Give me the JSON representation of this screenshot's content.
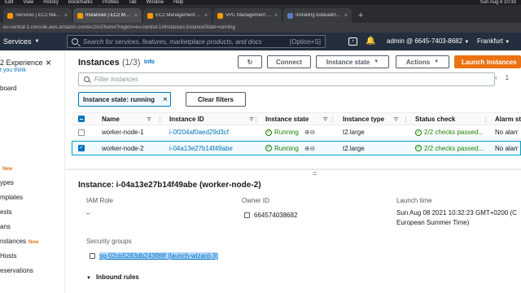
{
  "macbar": {
    "items": [
      "Edit",
      "View",
      "History",
      "Bookmarks",
      "Profiles",
      "Tab",
      "Window",
      "Help"
    ],
    "clock": "Sun Aug 8 10:33"
  },
  "browser": {
    "tabs": [
      {
        "title": "Services | EC2 Management Console",
        "icon": "aws-icon"
      },
      {
        "title": "Instances | EC2 Management Console",
        "icon": "aws-icon",
        "active": true
      },
      {
        "title": "EC2 Management Console",
        "icon": "aws-icon"
      },
      {
        "title": "VPC Management Console",
        "icon": "aws-icon"
      },
      {
        "title": "Installing kubeadm | Kubernetes",
        "icon": "kubernetes-icon"
      }
    ],
    "url": "eu-central-1.console.aws.amazon.com/ec2/v2/home?region=eu-central-1#Instances:instanceState=running"
  },
  "topnav": {
    "services": "Services",
    "search_placeholder": "Search for services, features, marketplace products, and docs",
    "search_hint": "[Option+S]",
    "account": "admin @ 6645-7403-8682",
    "region": "Frankfurt"
  },
  "sidebar": {
    "experience_title": "2 Experience",
    "experience_sub": "t you think",
    "items": [
      {
        "label": "board",
        "new": ""
      },
      {
        "label": "",
        "new": "New"
      },
      {
        "label": "ypes",
        "new": ""
      },
      {
        "label": "mplates",
        "new": ""
      },
      {
        "label": "ests",
        "new": ""
      },
      {
        "label": "ans",
        "new": ""
      },
      {
        "label": "nstances",
        "new": "New"
      },
      {
        "label": "Hosts",
        "new": ""
      },
      {
        "label": "eservations",
        "new": ""
      }
    ]
  },
  "main": {
    "title": "Instances",
    "count": "(1/3)",
    "info": "Info",
    "connect": "Connect",
    "instance_state": "Instance state",
    "actions": "Actions",
    "launch": "Launch instances",
    "filter_placeholder": "Filter instances",
    "page": "1",
    "chip": "Instance state: running",
    "clear_filters": "Clear filters"
  },
  "table": {
    "columns": [
      "Name",
      "Instance ID",
      "Instance state",
      "Instance type",
      "Status check",
      "Alarm st"
    ],
    "rows": [
      {
        "name": "worker-node-1",
        "id": "i-0f204af0aed29d3cf",
        "state": "Running",
        "type": "t2.large",
        "status": "2/2 checks passed...",
        "alarm": "No alarr",
        "selected": false
      },
      {
        "name": "worker-node-2",
        "id": "i-04a13e27b14f49abe",
        "state": "Running",
        "type": "t2.large",
        "status": "2/2 checks passed...",
        "alarm": "No alarr",
        "selected": true
      }
    ]
  },
  "details": {
    "title": "Instance: i-04a13e27b14f49abe (worker-node-2)",
    "iam_label": "IAM Role",
    "iam_value": "–",
    "owner_label": "Owner ID",
    "owner_value": "664574038682",
    "launch_label": "Launch time",
    "launch_value_1": "Sun Aug 08 2021 10:32:23 GMT+0200 (C",
    "launch_value_2": "European Summer Time)",
    "sg_label": "Security groups",
    "sg_value": "sg-02cb5283db243f89f (launch-wizard-3)",
    "inbound": "Inbound rules"
  },
  "colors": {
    "accent": "#ec7211",
    "link": "#0073bb",
    "nav": "#232f3e",
    "ok": "#1d8102"
  }
}
